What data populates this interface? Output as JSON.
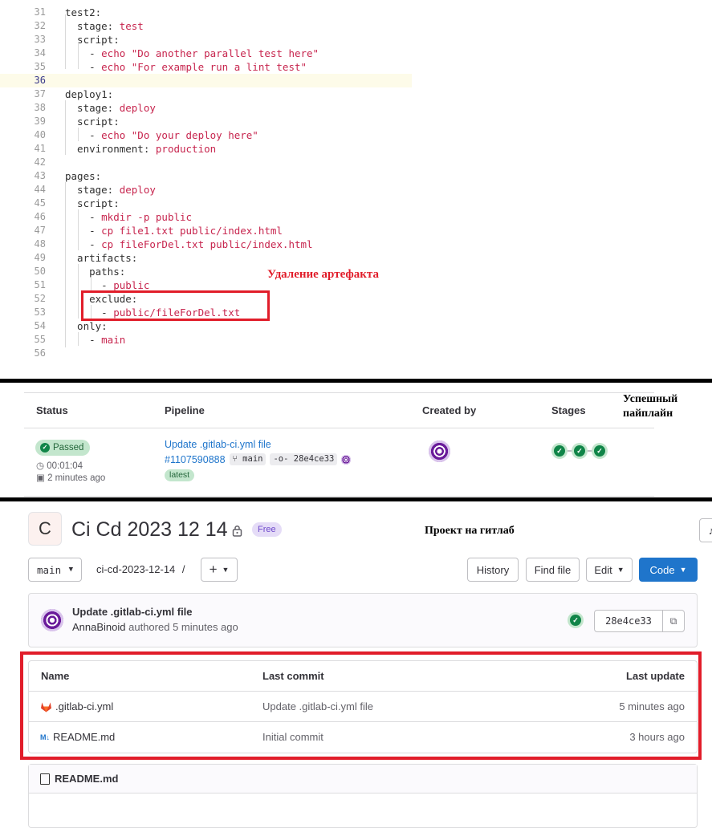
{
  "code": {
    "lines": [
      {
        "n": "31",
        "key": "test2:",
        "val": ""
      },
      {
        "n": "32",
        "key": "  stage: ",
        "val": "test"
      },
      {
        "n": "33",
        "key": "  script:",
        "val": ""
      },
      {
        "n": "34",
        "key": "    - ",
        "val": "echo \"Do another parallel test here\""
      },
      {
        "n": "35",
        "key": "    - ",
        "val": "echo \"For example run a lint test\""
      },
      {
        "n": "36",
        "key": "",
        "val": ""
      },
      {
        "n": "37",
        "key": "deploy1:",
        "val": ""
      },
      {
        "n": "38",
        "key": "  stage: ",
        "val": "deploy"
      },
      {
        "n": "39",
        "key": "  script:",
        "val": ""
      },
      {
        "n": "40",
        "key": "    - ",
        "val": "echo \"Do your deploy here\""
      },
      {
        "n": "41",
        "key": "  environment: ",
        "val": "production"
      },
      {
        "n": "42",
        "key": "",
        "val": ""
      },
      {
        "n": "43",
        "key": "pages:",
        "val": ""
      },
      {
        "n": "44",
        "key": "  stage: ",
        "val": "deploy"
      },
      {
        "n": "45",
        "key": "  script:",
        "val": ""
      },
      {
        "n": "46",
        "key": "    - ",
        "val": "mkdir -p public"
      },
      {
        "n": "47",
        "key": "    - ",
        "val": "cp file1.txt public/index.html"
      },
      {
        "n": "48",
        "key": "    - ",
        "val": "cp fileForDel.txt public/index.html"
      },
      {
        "n": "49",
        "key": "  artifacts:",
        "val": ""
      },
      {
        "n": "50",
        "key": "    paths:",
        "val": ""
      },
      {
        "n": "51",
        "key": "      - ",
        "val": "public"
      },
      {
        "n": "52",
        "key": "    exclude:",
        "val": ""
      },
      {
        "n": "53",
        "key": "      - ",
        "val": "public/fileForDel.txt"
      },
      {
        "n": "54",
        "key": "  only:",
        "val": ""
      },
      {
        "n": "55",
        "key": "    - ",
        "val": "main"
      },
      {
        "n": "56",
        "key": "",
        "val": ""
      }
    ],
    "annotation": "Удаление артефакта"
  },
  "pipeline_table": {
    "headers": {
      "status": "Status",
      "pipeline": "Pipeline",
      "created_by": "Created by",
      "stages": "Stages"
    },
    "status": "Passed",
    "duration": "00:01:04",
    "finished": "2 minutes ago",
    "commit_title": "Update .gitlab-ci.yml file",
    "pipeline_id": "#1107590888",
    "branch": "main",
    "sha": "28e4ce33",
    "tag": "latest",
    "annotation_line1": "Успешный",
    "annotation_line2": "пайплайн"
  },
  "project": {
    "avatar_letter": "C",
    "title": "Ci Cd 2023 12 14",
    "tier": "Free",
    "annotation": "Проект на гитлаб",
    "branch": "main",
    "path": "ci-cd-2023-12-14",
    "path_sep": "/",
    "buttons": {
      "history": "History",
      "find_file": "Find file",
      "edit": "Edit",
      "code": "Code"
    },
    "last_commit": {
      "title": "Update .gitlab-ci.yml file",
      "author": "AnnaBinoid",
      "action": "authored",
      "when": "5 minutes ago",
      "sha": "28e4ce33"
    },
    "file_headers": {
      "name": "Name",
      "last_commit": "Last commit",
      "last_update": "Last update"
    },
    "files": [
      {
        "name": ".gitlab-ci.yml",
        "commit": "Update .gitlab-ci.yml file",
        "updated": "5 minutes ago"
      },
      {
        "name": "README.md",
        "commit": "Initial commit",
        "updated": "3 hours ago"
      }
    ],
    "readme_title": "README.md"
  },
  "colors": {
    "annotation_red": "#e11d2a",
    "accent_blue": "#1f75cb",
    "success_green": "#108548"
  }
}
